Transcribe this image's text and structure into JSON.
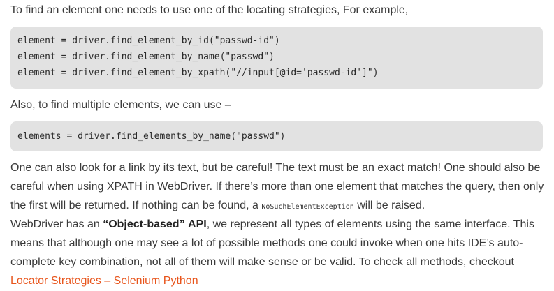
{
  "intro": "To find an element one needs to use one of the locating strategies, For example,",
  "code_single": [
    "element = driver.find_element_by_id(\"passwd-id\")",
    "element = driver.find_element_by_name(\"passwd\")",
    "element = driver.find_element_by_xpath(\"//input[@id='passwd-id']\")"
  ],
  "multiple_intro": "Also, to find multiple elements, we can use –",
  "code_multiple": "elements = driver.find_elements_by_name(\"passwd\")",
  "para1": {
    "text_before": "One can also look for a link by its text, but be careful! The text must be an exact match! One should also be careful when using XPATH in WebDriver. If there’s more than one element that matches the query, then only the first will be returned. If nothing can be found, a ",
    "exception": "NoSuchElementException",
    "text_after": " will be raised."
  },
  "para2": {
    "text_before": "WebDriver has an ",
    "bold1": "“Object-based”",
    "space": " ",
    "bold2": "API",
    "text_after": ", we represent all types of elements using the same interface. This means that although one may see a lot of possible methods one could invoke when one hits IDE’s auto-complete key combination, not all of them will make sense or be valid. To check all methods, checkout",
    "link_text": "Locator Strategies – Selenium Python"
  },
  "colors": {
    "link": "#e8551c",
    "code_background": "#e2e2e2",
    "text": "#3a3a3a"
  }
}
